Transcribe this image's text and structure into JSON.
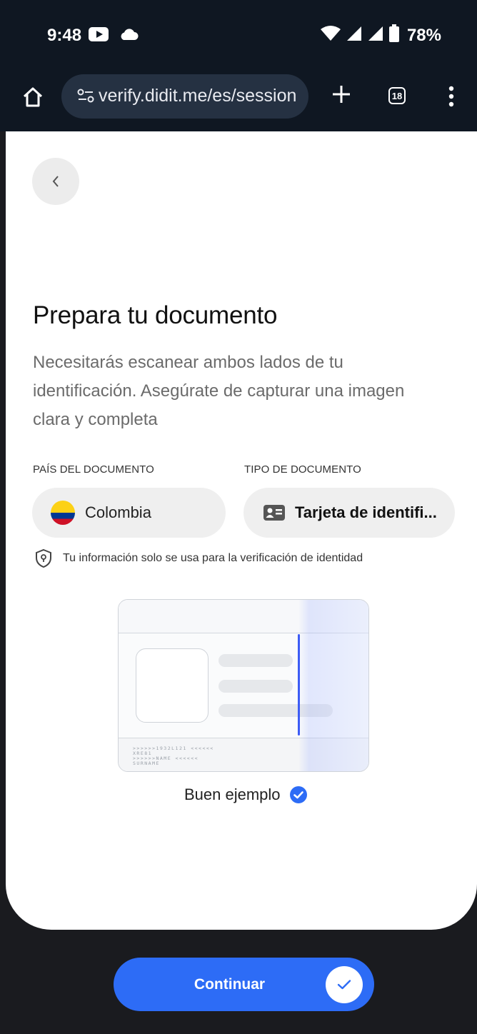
{
  "status_bar": {
    "time": "9:48",
    "battery": "78%",
    "left_icons": [
      "youtube-icon",
      "cloud-icon"
    ],
    "right_icons": [
      "wifi-icon",
      "signal-icon",
      "signal-icon",
      "battery-icon"
    ]
  },
  "browser": {
    "url": "verify.didit.me/es/session",
    "tab_count": "18"
  },
  "page": {
    "title": "Prepara tu documento",
    "subtitle": "Necesitarás escanear ambos lados de tu identificación. Asegúrate de capturar una imagen clara y completa",
    "country_label": "PAÍS DEL DOCUMENTO",
    "country_value": "Colombia",
    "doctype_label": "TIPO DE DOCUMENTO",
    "doctype_value": "Tarjeta de identifi...",
    "privacy_note": "Tu información solo se usa para la verificación de identidad",
    "id_mrz": ">>>>>>1932L121 <<<<<<\nXRE81\n>>>>>>NAME <<<<<<\nSURNAME",
    "example_caption": "Buen ejemplo",
    "continue_label": "Continuar"
  },
  "colors": {
    "primary": "#2d6cf6",
    "topbar": "#0f1722",
    "url_pill": "#253142",
    "scan_line": "#3d5cf5"
  }
}
